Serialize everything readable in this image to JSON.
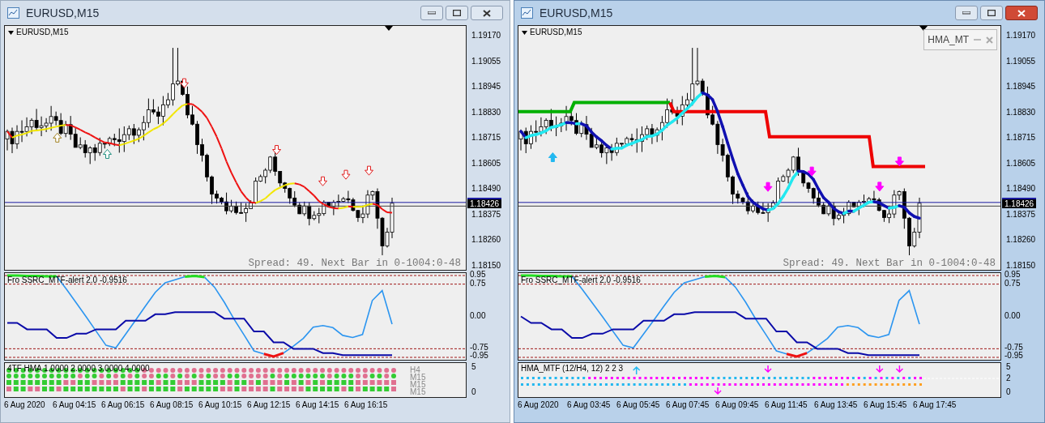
{
  "windows": [
    {
      "title": "EURUSD,M15",
      "active": false,
      "chart": {
        "kind": "ma",
        "symbol": "EURUSD,M15",
        "price_ticks": [
          "1.19170",
          "1.19055",
          "1.18945",
          "1.18830",
          "1.18715",
          "1.18605",
          "1.18490",
          "1.18375",
          "1.18260",
          "1.18150"
        ],
        "current_price": "1.18426",
        "spread": "Spread: 49. Next Bar in 0-1004:0-48"
      },
      "oscillator": {
        "label": "Fro SSRC_MTF-alert 2.0 -0.9516",
        "chart_data": {
          "type": "line",
          "ylim": [
            -0.95,
            0.95
          ],
          "yticks": [
            {
              "value": 0.95,
              "label": "0.95"
            },
            {
              "value": 0.75,
              "label": "0.75"
            },
            {
              "value": 0,
              "label": "0.00"
            },
            {
              "value": -0.75,
              "label": "-0.75"
            },
            {
              "value": -0.95,
              "label": "-0.95"
            }
          ],
          "series": [
            {
              "color": "#2b95f0",
              "values": [
                null,
                null,
                null,
                null,
                null,
                0.93,
                0.63,
                0.31,
                -0.01,
                -0.34,
                -0.67,
                -0.73,
                -0.41,
                -0.09,
                0.24,
                0.56,
                0.78,
                0.85,
                0.92,
                null,
                0.91,
                0.68,
                0.33,
                -0.07,
                -0.43,
                -0.8,
                -0.87,
                null,
                -0.85,
                -0.69,
                -0.51,
                -0.25,
                -0.21,
                -0.26,
                -0.44,
                -0.49,
                -0.42,
                0.37,
                0.6,
                -0.18
              ]
            },
            {
              "color": "#0a0aa8",
              "values": [
                -0.15,
                -0.15,
                -0.3,
                -0.3,
                -0.3,
                -0.5,
                -0.5,
                -0.4,
                -0.4,
                -0.3,
                -0.3,
                -0.3,
                -0.1,
                -0.1,
                -0.1,
                0.05,
                0.05,
                0.1,
                0.1,
                0.1,
                0.1,
                0.1,
                -0.05,
                -0.05,
                -0.05,
                -0.35,
                -0.35,
                -0.6,
                -0.6,
                -0.75,
                -0.75,
                -0.75,
                -0.85,
                -0.85,
                -0.9,
                -0.9,
                -0.9,
                -0.9,
                -0.9,
                -0.9
              ]
            },
            {
              "color": "#22dd22",
              "values": [
                0.95,
                0.95,
                0.94,
                0.94,
                0.93,
                0.93,
                null,
                null,
                null,
                null,
                null,
                null,
                null,
                null,
                null,
                null,
                null,
                null,
                0.92,
                0.94,
                0.91,
                null,
                null,
                null,
                null,
                null,
                null,
                null,
                null,
                null,
                null,
                null,
                null,
                null,
                null,
                null,
                null,
                null,
                null,
                null
              ]
            },
            {
              "color": "#ee1111",
              "values": [
                null,
                null,
                null,
                null,
                null,
                null,
                null,
                null,
                null,
                null,
                null,
                null,
                null,
                null,
                null,
                null,
                null,
                null,
                null,
                null,
                null,
                null,
                null,
                null,
                null,
                null,
                -0.87,
                -0.93,
                -0.85,
                null,
                null,
                null,
                null,
                null,
                null,
                null,
                null,
                null,
                null,
                null
              ]
            }
          ]
        }
      },
      "indicator": {
        "kind": "grid",
        "label": "4TF HMA 1.0000 2.0000 3.0000 4.0000",
        "ticks": [
          "5",
          "0"
        ],
        "row_labels": [
          "H4",
          "M15",
          "M15",
          "M15"
        ]
      },
      "time_labels": [
        "6 Aug 2020",
        "6 Aug 04:15",
        "6 Aug 06:15",
        "6 Aug 08:15",
        "6 Aug 10:15",
        "6 Aug 12:15",
        "6 Aug 14:15",
        "6 Aug 16:15"
      ]
    },
    {
      "title": "EURUSD,M15",
      "active": true,
      "chart": {
        "kind": "hma",
        "symbol": "EURUSD,M15",
        "price_ticks": [
          "1.19170",
          "1.19055",
          "1.18945",
          "1.18830",
          "1.18715",
          "1.18605",
          "1.18490",
          "1.18375",
          "1.18260",
          "1.18150"
        ],
        "current_price": "1.18426",
        "spread": "Spread: 49. Next Bar in 0-1004:0-48",
        "panel": {
          "title": "HMA_MT"
        }
      },
      "oscillator": {
        "label": "Fro SSRC_MTF-alert 2.0 -0.9516",
        "chart_data": {
          "type": "line",
          "ylim": [
            -0.95,
            0.95
          ],
          "yticks": [
            {
              "value": 0.95,
              "label": "0.95"
            },
            {
              "value": 0.75,
              "label": "0.75"
            },
            {
              "value": 0,
              "label": "0.00"
            },
            {
              "value": -0.75,
              "label": "-0.75"
            },
            {
              "value": -0.95,
              "label": "-0.95"
            }
          ],
          "series": [
            {
              "color": "#2b95f0",
              "values": [
                null,
                null,
                null,
                null,
                null,
                0.93,
                0.63,
                0.31,
                -0.01,
                -0.34,
                -0.67,
                -0.73,
                -0.41,
                -0.09,
                0.24,
                0.56,
                0.78,
                0.85,
                0.92,
                null,
                0.91,
                0.68,
                0.33,
                -0.07,
                -0.43,
                -0.8,
                -0.87,
                null,
                -0.85,
                -0.69,
                -0.51,
                -0.25,
                -0.21,
                -0.26,
                -0.44,
                -0.49,
                -0.42,
                0.37,
                0.6,
                -0.18
              ]
            },
            {
              "color": "#0a0aa8",
              "values": [
                0.0,
                -0.15,
                -0.15,
                -0.3,
                -0.3,
                -0.5,
                -0.5,
                -0.4,
                -0.4,
                -0.3,
                -0.3,
                -0.3,
                -0.1,
                -0.1,
                -0.1,
                0.05,
                0.05,
                0.1,
                0.1,
                0.1,
                0.1,
                0.1,
                -0.05,
                -0.05,
                -0.05,
                -0.35,
                -0.35,
                -0.6,
                -0.6,
                -0.75,
                -0.75,
                -0.75,
                -0.85,
                -0.85,
                -0.9,
                -0.9,
                -0.9,
                -0.9,
                -0.9,
                -0.9
              ]
            },
            {
              "color": "#22dd22",
              "values": [
                0.95,
                0.95,
                0.94,
                0.94,
                0.93,
                0.93,
                null,
                null,
                null,
                null,
                null,
                null,
                null,
                null,
                null,
                null,
                null,
                null,
                0.92,
                0.94,
                0.91,
                null,
                null,
                null,
                null,
                null,
                null,
                null,
                null,
                null,
                null,
                null,
                null,
                null,
                null,
                null,
                null,
                null,
                null,
                null
              ]
            },
            {
              "color": "#ee1111",
              "values": [
                null,
                null,
                null,
                null,
                null,
                null,
                null,
                null,
                null,
                null,
                null,
                null,
                null,
                null,
                null,
                null,
                null,
                null,
                null,
                null,
                null,
                null,
                null,
                null,
                null,
                null,
                -0.87,
                -0.93,
                -0.85,
                null,
                null,
                null,
                null,
                null,
                null,
                null,
                null,
                null,
                null,
                null
              ]
            }
          ]
        }
      },
      "indicator": {
        "kind": "lines",
        "label": "HMA_MTF (12/H4, 12) 2 2 3",
        "ticks": [
          "5",
          "2",
          "0"
        ]
      },
      "time_labels": [
        "6 Aug 2020",
        "6 Aug 03:45",
        "6 Aug 05:45",
        "6 Aug 07:45",
        "6 Aug 09:45",
        "6 Aug 11:45",
        "6 Aug 13:45",
        "6 Aug 15:45",
        "6 Aug 17:45"
      ]
    }
  ]
}
